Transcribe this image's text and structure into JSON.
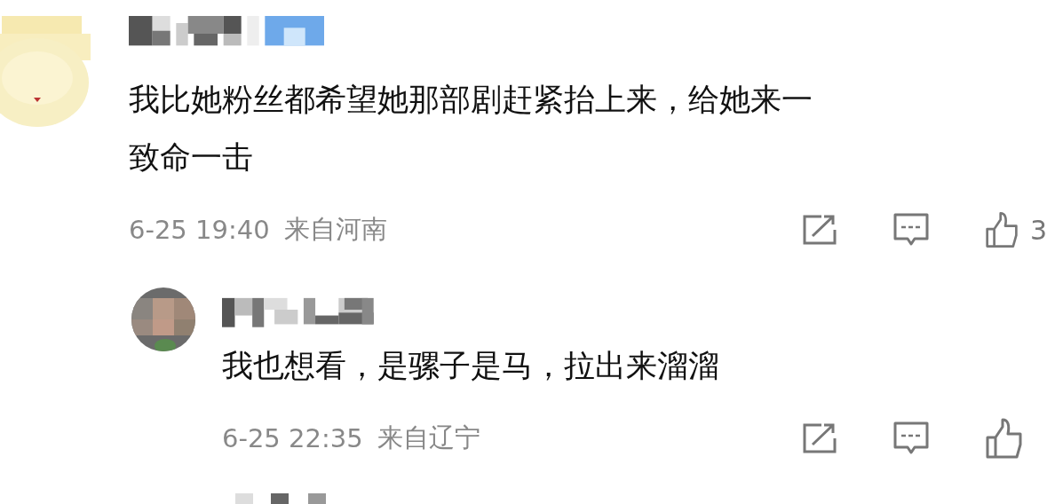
{
  "comments": [
    {
      "lines": [
        "我比她粉丝都希望她那部剧赶紧抬上来，给她来一",
        "致命一击"
      ],
      "date": "6-25 19:40",
      "location": "来自河南",
      "likes": "3",
      "reply": false
    },
    {
      "lines": [
        "我也想看，是骡子是马，拉出来溜溜"
      ],
      "date": "6-25 22:35",
      "location": "来自辽宁",
      "reply": true
    }
  ]
}
